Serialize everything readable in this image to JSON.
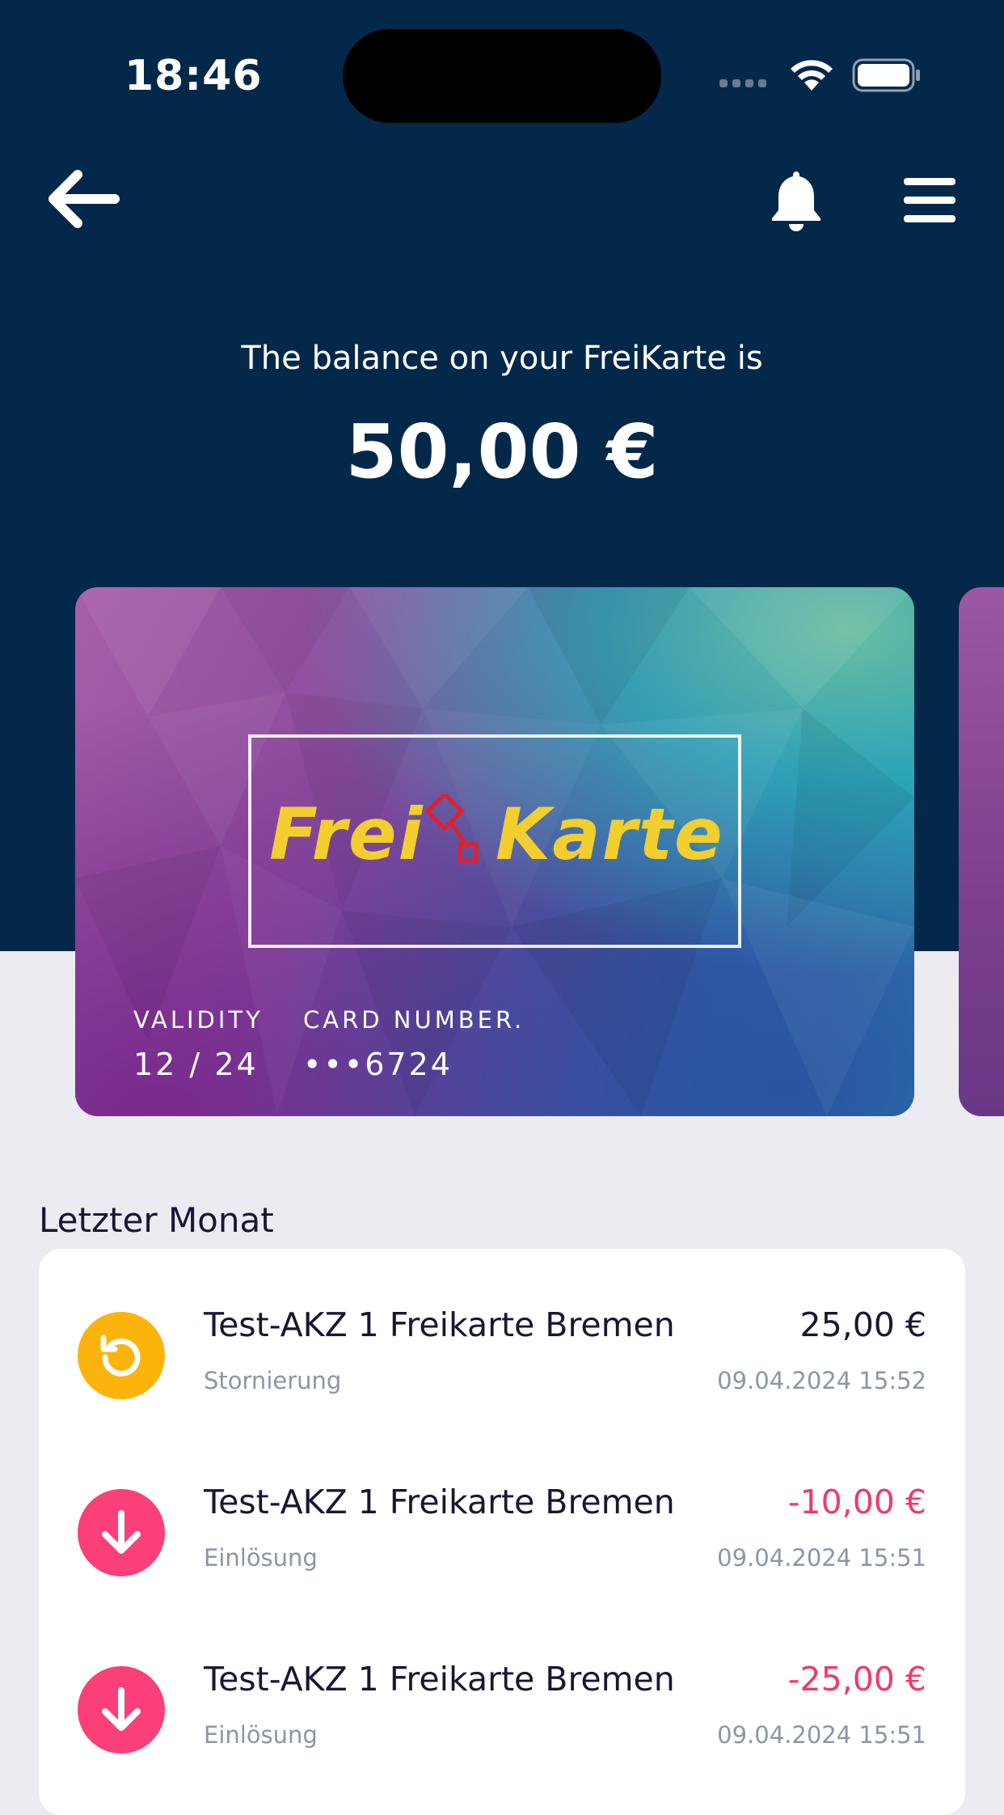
{
  "status_bar": {
    "time": "18:46"
  },
  "header": {
    "balance_label": "The balance on your FreiKarte is",
    "balance_value": "50,00 €"
  },
  "card": {
    "logo_left": "Frei",
    "logo_right": "Karte",
    "validity_label": "VALIDITY",
    "validity_value": "12 / 24",
    "number_label": "CARD NUMBER.",
    "number_value": "•••6724",
    "colors": {
      "logo": "#f2cf2e",
      "key": "#e0202e"
    }
  },
  "transactions": {
    "section_title": "Letzter Monat",
    "items": [
      {
        "icon": "undo-icon",
        "title": "Test-AKZ 1 Freikarte Bremen",
        "type": "Stornierung",
        "amount": "25,00 €",
        "date": "09.04.2024 15:52"
      },
      {
        "icon": "arrow-down-icon",
        "title": "Test-AKZ 1 Freikarte Bremen",
        "type": "Einlösung",
        "amount": "-10,00 €",
        "date": "09.04.2024 15:51"
      },
      {
        "icon": "arrow-down-icon",
        "title": "Test-AKZ 1 Freikarte Bremen",
        "type": "Einlösung",
        "amount": "-25,00 €",
        "date": "09.04.2024 15:51"
      }
    ]
  },
  "colors": {
    "header_bg": "#03284a",
    "page_bg": "#ecebf2",
    "refund_icon": "#fbb40c",
    "redeem_icon": "#fb3f78",
    "negative_amount": "#f03a6b"
  }
}
